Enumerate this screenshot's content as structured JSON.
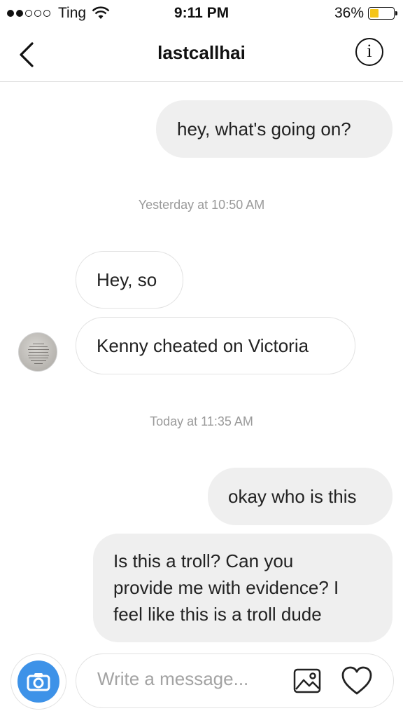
{
  "status_bar": {
    "carrier": "Ting",
    "time": "9:11 PM",
    "battery": "36%",
    "battery_level": 0.36,
    "battery_color": "#f5c518"
  },
  "header": {
    "title": "lastcallhai",
    "back_icon": "chevron-left-icon",
    "info_icon": "info-icon",
    "info_glyph": "i"
  },
  "messages": [
    {
      "side": "out",
      "text": "hey, what's going on?"
    },
    {
      "type": "timestamp",
      "text": "Yesterday at 10:50 AM"
    },
    {
      "side": "in",
      "text": "Hey, so"
    },
    {
      "side": "in",
      "text": "Kenny cheated on Victoria"
    },
    {
      "type": "timestamp",
      "text": "Today at 11:35 AM"
    },
    {
      "side": "out",
      "text": "okay who is this"
    },
    {
      "side": "out",
      "lines": [
        "Is this a troll? Can you",
        "provide me with evidence? I",
        "feel like this is a troll dude"
      ]
    }
  ],
  "composer": {
    "placeholder": "Write a message...",
    "camera_icon": "camera-icon",
    "gallery_icon": "image-gallery-icon",
    "like_icon": "heart-icon",
    "accent": "#3d92e8"
  }
}
